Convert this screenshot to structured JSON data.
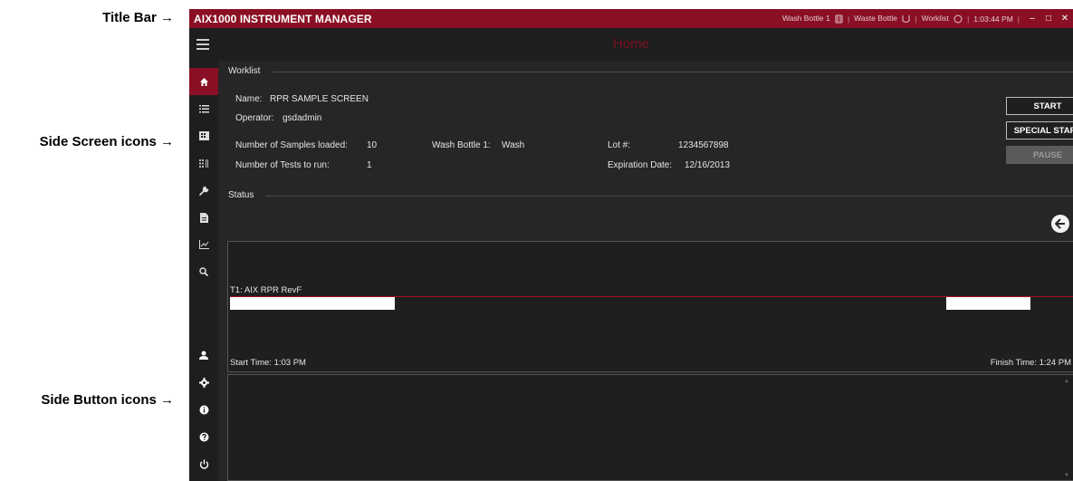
{
  "annotations": {
    "title_bar": "Title Bar →",
    "side_screen_icons": "Side Screen icons →",
    "side_button_icons": "Side Button icons →"
  },
  "titlebar": {
    "app_name": "AIX1000 INSTRUMENT MANAGER",
    "wash_bottle_label": "Wash Bottle 1",
    "waste_bottle_label": "Waste Bottle",
    "worklist_label": "Worklist",
    "time": "1:03:44 PM",
    "minimize_glyph": "–",
    "maximize_glyph": "□",
    "close_glyph": "✕"
  },
  "header": {
    "title": "Home"
  },
  "sidebar": {
    "screen_items": [
      {
        "name": "home-icon",
        "glyph": "⌂"
      },
      {
        "name": "worklist-icon",
        "glyph": "☰"
      },
      {
        "name": "plate-icon",
        "glyph": "▦"
      },
      {
        "name": "samples-icon",
        "glyph": "∷"
      },
      {
        "name": "wrench-icon",
        "glyph": "⚒"
      },
      {
        "name": "report-icon",
        "glyph": "▤"
      },
      {
        "name": "chart-icon",
        "glyph": "↗"
      },
      {
        "name": "search-icon",
        "glyph": "⌕"
      }
    ],
    "button_items": [
      {
        "name": "user-icon",
        "glyph": "▲"
      },
      {
        "name": "settings-icon",
        "glyph": "⚙"
      },
      {
        "name": "info-icon",
        "glyph": "i"
      },
      {
        "name": "help-icon",
        "glyph": "?"
      },
      {
        "name": "power-icon",
        "glyph": "⏻"
      }
    ]
  },
  "worklist": {
    "section_label": "Worklist",
    "name_label": "Name:",
    "name_value": "RPR SAMPLE SCREEN",
    "operator_label": "Operator:",
    "operator_value": "gsdadmin",
    "samples_label": "Number of Samples loaded:",
    "samples_value": "10",
    "tests_label": "Number of Tests to run:",
    "tests_value": "1",
    "wash_bottle_label": "Wash Bottle 1:",
    "wash_bottle_value": "Wash",
    "lot_label": "Lot #:",
    "lot_value": "1234567898",
    "expiration_label": "Expiration Date:",
    "expiration_value": "12/16/2013"
  },
  "buttons": {
    "start": "START",
    "special_start": "SPECIAL START",
    "pause": "PAUSE"
  },
  "status": {
    "section_label": "Status",
    "test_name": "T1: AIX RPR RevF",
    "start_time": "Start Time: 1:03 PM",
    "finish_time": "Finish Time: 1:24 PM"
  },
  "colors": {
    "brand": "#8a0f24",
    "background": "#262626",
    "panel": "#1f1f1f"
  }
}
